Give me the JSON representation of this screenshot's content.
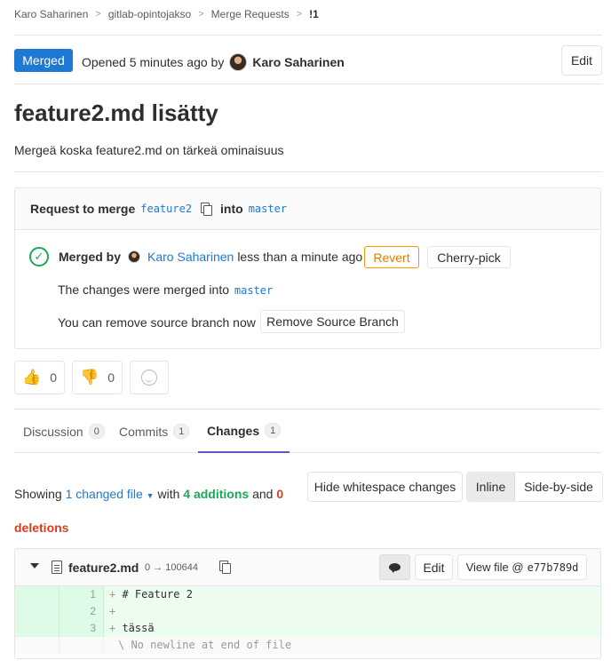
{
  "breadcrumb": {
    "user": "Karo Saharinen",
    "project": "gitlab-opintojakso",
    "section": "Merge Requests",
    "item": "!1"
  },
  "header": {
    "status": "Merged",
    "opened_prefix": "Opened 5 minutes ago by",
    "author": "Karo Saharinen",
    "edit_label": "Edit"
  },
  "mr": {
    "title": "feature2.md lisätty",
    "description": "Mergeä koska feature2.md on tärkeä ominaisuus"
  },
  "widget": {
    "request_prefix": "Request to merge",
    "source_branch": "feature2",
    "into_label": "into",
    "target_branch": "master",
    "merged_by_label": "Merged by",
    "merged_by_user": "Karo Saharinen",
    "merged_time": "less than a minute ago",
    "revert_label": "Revert",
    "cherry_pick_label": "Cherry-pick",
    "merged_into_prefix": "The changes were merged into",
    "merged_into_branch": "master",
    "remove_source_text": "You can remove source branch now",
    "remove_source_button": "Remove Source Branch"
  },
  "awards": {
    "thumbs_up_count": "0",
    "thumbs_down_count": "0"
  },
  "tabs": [
    {
      "label": "Discussion",
      "count": "0"
    },
    {
      "label": "Commits",
      "count": "1"
    },
    {
      "label": "Changes",
      "count": "1"
    }
  ],
  "diff_summary": {
    "showing": "Showing",
    "changed_files": "1 changed file",
    "with": "with",
    "additions": "4 additions",
    "and": "and",
    "deletions_count": "0",
    "deletions_label": "deletions",
    "hide_whitespace": "Hide whitespace changes",
    "inline": "Inline",
    "side_by_side": "Side-by-side"
  },
  "file": {
    "name": "feature2.md",
    "mode": "0 → 100644",
    "edit_label": "Edit",
    "view_file_label": "View file @",
    "sha": "e77b789d",
    "lines": [
      {
        "num": "1",
        "prefix": "+",
        "text": " # Feature 2"
      },
      {
        "num": "2",
        "prefix": "+",
        "text": ""
      },
      {
        "num": "3",
        "prefix": "+",
        "text": " tässä"
      }
    ],
    "no_newline": "\\ No newline at end of file"
  },
  "colors": {
    "accent_blue": "#1f78d1",
    "merged_badge": "#1f78d1",
    "success_green": "#1aaa55",
    "danger_red": "#db3b21",
    "warning_orange": "#fc9403",
    "tab_active_underline": "#6b4fbb",
    "diff_add_bg": "#ecfdf0"
  },
  "icons": {
    "copy": "copy-icon",
    "check": "check-circle-icon",
    "thumbs_up": "thumbs-up-icon",
    "thumbs_down": "thumbs-down-icon",
    "emoji": "smiley-icon",
    "comment": "comment-icon",
    "file": "file-icon",
    "collapse": "chevron-down-icon"
  }
}
